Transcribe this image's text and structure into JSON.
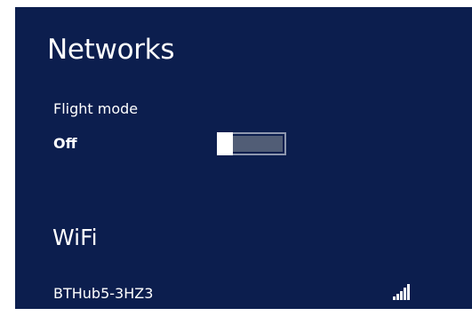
{
  "panel": {
    "title": "Networks",
    "flight_mode": {
      "label": "Flight mode",
      "state": "Off",
      "on": false
    },
    "wifi": {
      "heading": "WiFi",
      "networks": [
        {
          "ssid": "BTHub5-3HZ3",
          "signal_bars": 5,
          "icon": "wifi-signal-icon"
        }
      ]
    }
  },
  "colors": {
    "background": "#0c1e4e",
    "text": "#ffffff",
    "toggle_track": "#515d76",
    "toggle_border": "#8e97ae"
  }
}
